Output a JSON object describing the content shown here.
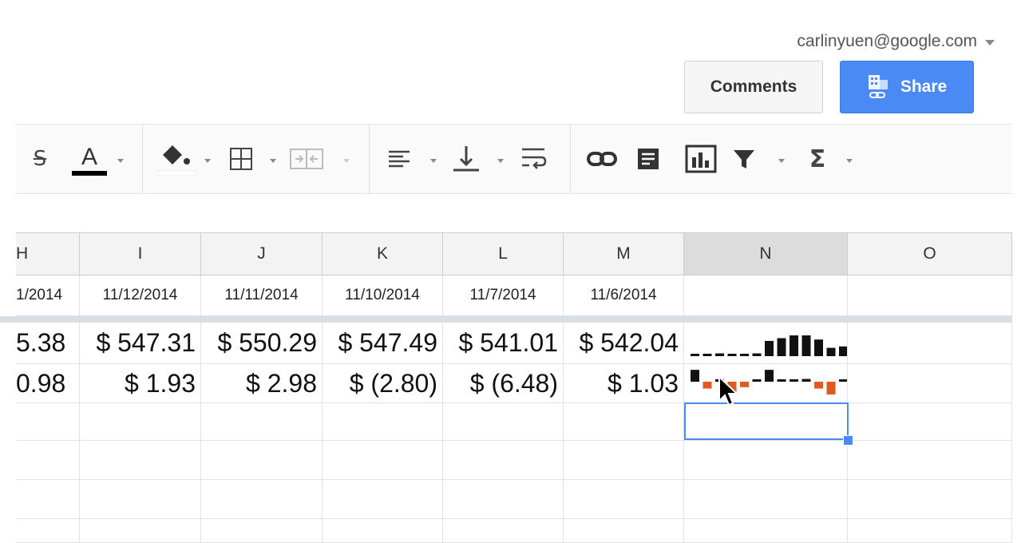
{
  "account": {
    "email": "carlinyuen@google.com"
  },
  "header": {
    "comments_label": "Comments",
    "share_label": "Share"
  },
  "toolbar": {
    "icons": [
      "strikethrough-icon",
      "text-color-icon",
      "fill-color-icon",
      "borders-icon",
      "merge-cells-icon",
      "horizontal-align-icon",
      "vertical-align-icon",
      "text-wrap-icon",
      "link-icon",
      "comment-icon",
      "chart-icon",
      "filter-icon",
      "functions-icon"
    ],
    "text_color": "#000000",
    "fill_color": "#ffffff"
  },
  "columns": [
    "H",
    "I",
    "J",
    "K",
    "L",
    "M",
    "N",
    "O"
  ],
  "selected_column": "N",
  "rows": {
    "dates": [
      "1/2014",
      "11/12/2014",
      "11/11/2014",
      "11/10/2014",
      "11/7/2014",
      "11/6/2014",
      "",
      ""
    ],
    "prices": [
      "5.38",
      "$ 547.31",
      "$ 550.29",
      "$ 547.49",
      "$ 541.01",
      "$ 542.04",
      "",
      ""
    ],
    "changes": [
      "0.98",
      "$ 1.93",
      "$ 2.98",
      "$ (2.80)",
      "$ (6.48)",
      "$ 1.03",
      "",
      ""
    ]
  },
  "sparklines": {
    "prices": {
      "values": [
        536,
        536,
        537,
        536,
        536,
        537,
        546,
        548,
        550,
        550,
        547,
        541,
        542
      ],
      "min": 535,
      "color": "#111111"
    },
    "changes": {
      "values": [
        2.6,
        -1.5,
        0.4,
        -2.8,
        -1.2,
        0.3,
        2.6,
        0.4,
        0.4,
        0.6,
        -1.5,
        -2.8,
        0.4
      ],
      "positive_color": "#111111",
      "negative_color": "#e05a1f"
    }
  },
  "accent": "#4a8af4"
}
